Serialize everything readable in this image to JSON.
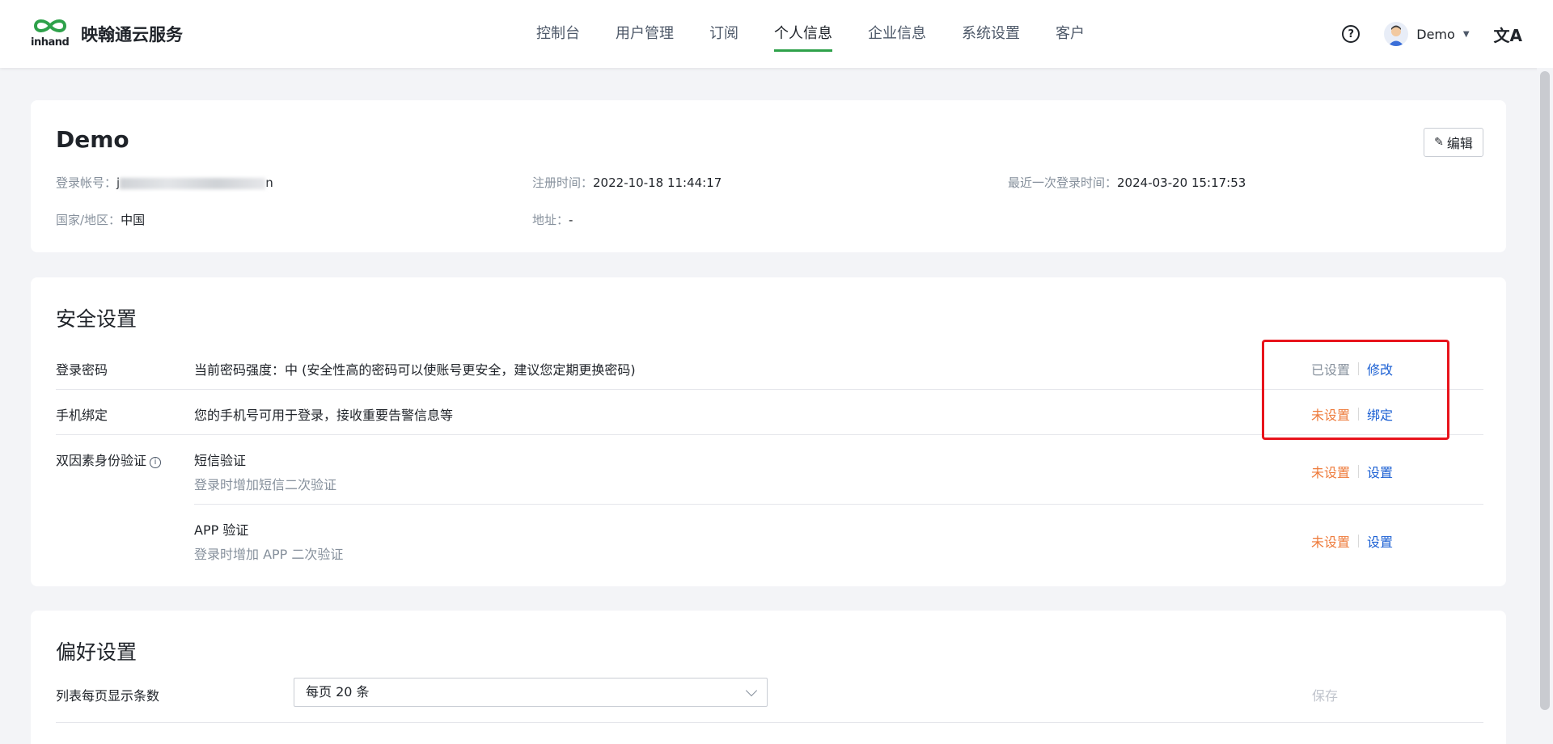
{
  "header": {
    "logo_text": "inhand",
    "brand": "映翰通云服务",
    "nav": [
      {
        "label": "控制台",
        "active": false
      },
      {
        "label": "用户管理",
        "active": false
      },
      {
        "label": "订阅",
        "active": false
      },
      {
        "label": "个人信息",
        "active": true
      },
      {
        "label": "企业信息",
        "active": false
      },
      {
        "label": "系统设置",
        "active": false
      },
      {
        "label": "客户",
        "active": false
      }
    ],
    "help_glyph": "?",
    "user_name": "Demo",
    "lang_glyph": "文A"
  },
  "profile": {
    "name": "Demo",
    "edit_label": "编辑",
    "account_label": "登录帐号：",
    "account_value_partial": "j",
    "account_value_tail": "n",
    "register_label": "注册时间：",
    "register_value": "2022-10-18 11:44:17",
    "last_login_label": "最近一次登录时间：",
    "last_login_value": "2024-03-20 15:17:53",
    "country_label": "国家/地区：",
    "country_value": "中国",
    "address_label": "地址：",
    "address_value": "-"
  },
  "security": {
    "title": "安全设置",
    "rows": [
      {
        "label": "登录密码",
        "desc": "当前密码强度：中 (安全性高的密码可以使账号更安全，建议您定期更换密码)",
        "status": "已设置",
        "action": "修改"
      },
      {
        "label": "手机绑定",
        "desc": "您的手机号可用于登录，接收重要告警信息等",
        "status": "未设置",
        "action": "绑定"
      },
      {
        "label": "双因素身份验证",
        "desc": "短信验证",
        "sub": "登录时增加短信二次验证",
        "status": "未设置",
        "action": "设置"
      },
      {
        "label": "",
        "desc": "APP 验证",
        "sub": "登录时增加 APP 二次验证",
        "status": "未设置",
        "action": "设置"
      }
    ],
    "status_colors": {
      "set": "#86909c",
      "unset": "#ee7a3a",
      "action": "#1a5fd3"
    }
  },
  "preferences": {
    "title": "偏好设置",
    "page_size_label": "列表每页显示条数",
    "page_size_value": "每页 20 条",
    "save_label": "保存"
  }
}
